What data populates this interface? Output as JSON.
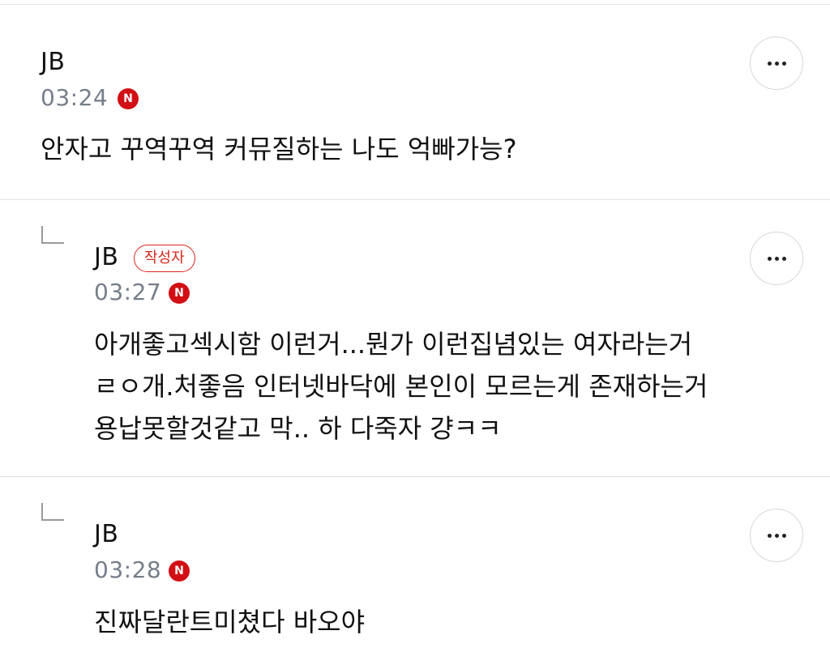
{
  "comments": [
    {
      "author": "JB",
      "time": "03:24",
      "badge_letter": "N",
      "text": "안자고 꾸역꾸역 커뮤질하는 나도 억빠가능?",
      "is_reply": false
    },
    {
      "author": "JB",
      "author_badge": "작성자",
      "time": "03:27",
      "badge_letter": "N",
      "text": "아개좋고섹시함 이런거...뭔가 이런집념있는 여자라는거\nㄹㅇ개.처좋음 인터넷바닥에 본인이 모르는게 존재하는거\n용납못할것같고 막.. 하 다죽자 걍ㅋㅋ",
      "is_reply": true
    },
    {
      "author": "JB",
      "time": "03:28",
      "badge_letter": "N",
      "text": "진짜달란트미쳤다 바오야",
      "is_reply": true
    }
  ],
  "icons": {
    "new": "new-badge-icon",
    "more": "more-horizontal-icon",
    "reply": "reply-arrow-icon"
  },
  "colors": {
    "new_badge": "#d10f14",
    "author_badge": "#d9261c",
    "time_text": "#767e8a"
  }
}
